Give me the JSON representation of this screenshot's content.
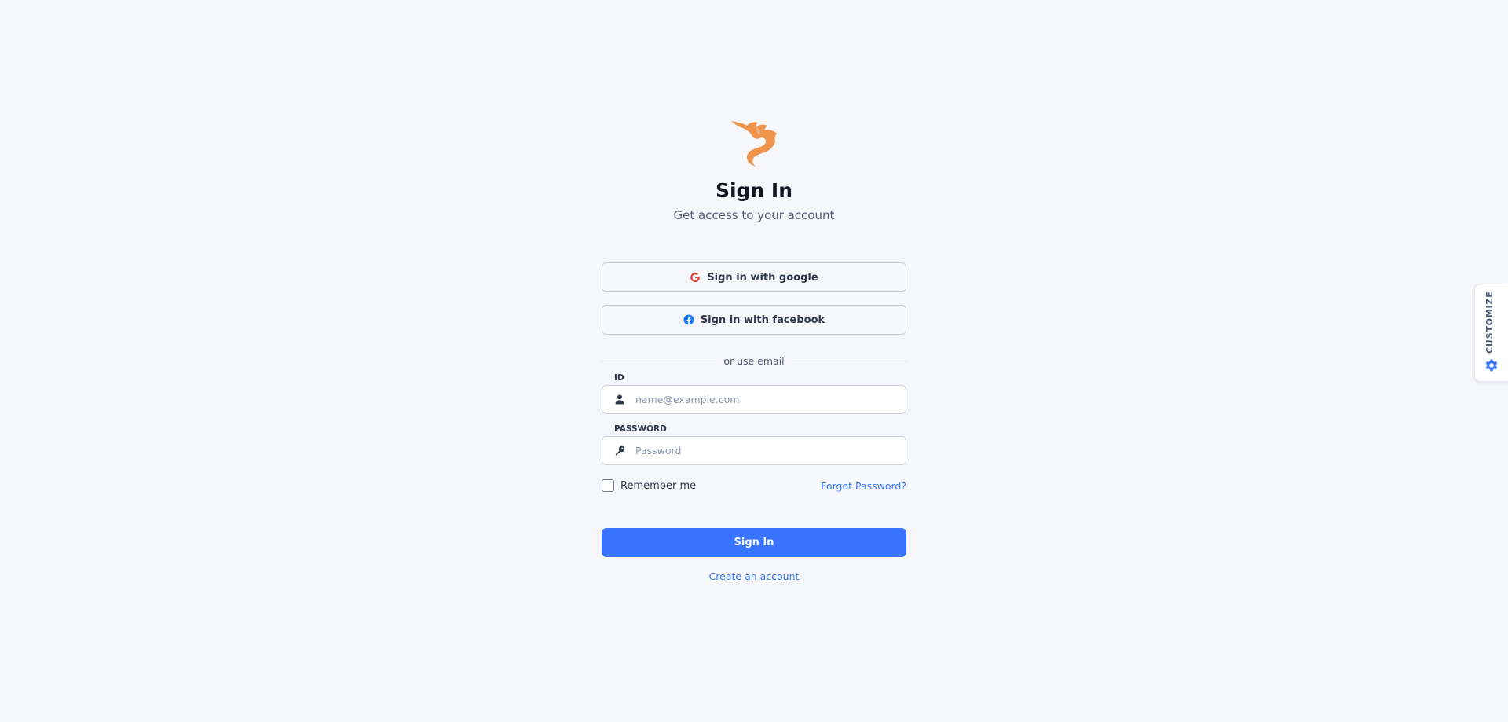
{
  "brand": {
    "logo_icon": "phoenix-logo-icon",
    "accent_color": "#f0944c"
  },
  "header": {
    "title": "Sign In",
    "subtitle": "Get access to your account"
  },
  "social": {
    "google": {
      "label": "Sign in with google",
      "icon": "google-icon"
    },
    "facebook": {
      "label": "Sign in with facebook",
      "icon": "facebook-icon"
    }
  },
  "divider": {
    "text": "or use email"
  },
  "form": {
    "id": {
      "label": "ID",
      "placeholder": "name@example.com",
      "value": "",
      "icon": "user-icon"
    },
    "password": {
      "label": "PASSWORD",
      "placeholder": "Password",
      "value": "",
      "icon": "key-icon"
    },
    "remember_label": "Remember me",
    "remember_checked": false,
    "forgot_label": "Forgot Password?",
    "submit_label": "Sign In",
    "create_account_label": "Create an account"
  },
  "customize": {
    "label": "CUSTOMIZE",
    "icon": "gear-icon"
  },
  "colors": {
    "primary": "#3874ff",
    "background": "#f5f7fa",
    "facebook_blue": "#1877f2",
    "google_red": "#ea4335"
  }
}
